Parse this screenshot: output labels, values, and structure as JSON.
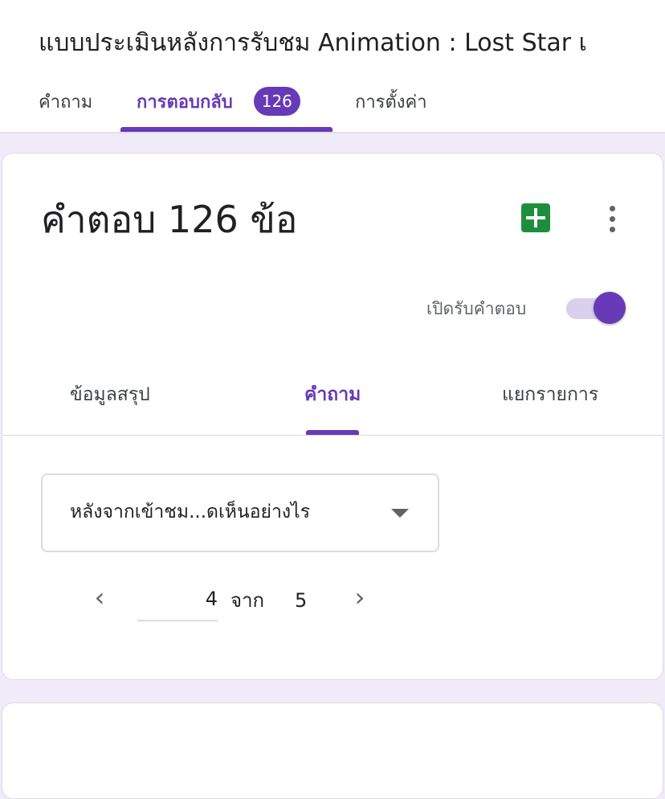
{
  "header": {
    "form_title": "แบบประเมินหลังการรับชม Animation : Lost Star เ",
    "tabs": [
      {
        "label": "คำถาม"
      },
      {
        "label": "การตอบกลับ",
        "badge": "126"
      },
      {
        "label": "การตั้งค่า"
      }
    ],
    "active_tab": 1
  },
  "responses": {
    "count_title": "คำตอบ 126 ข้อ",
    "sheets_icon": "google-sheets-icon",
    "more_icon": "more-vert-icon",
    "accepting_label": "เปิดรับคำตอบ",
    "accepting": true,
    "subtabs": [
      "ข้อมูลสรุป",
      "คำถาม",
      "แยกรายการ"
    ],
    "active_subtab": 1,
    "question_select": "หลังจากเข้าชม...ดเห็นอย่างไร",
    "pager": {
      "prev_icon": "chevron-left-icon",
      "next_icon": "chevron-right-icon",
      "current": "4",
      "of_label": "จาก",
      "total": "5"
    }
  },
  "colors": {
    "accent": "#673ab7",
    "background": "#f0ebf8",
    "sheets_green": "#1e8e3e"
  }
}
